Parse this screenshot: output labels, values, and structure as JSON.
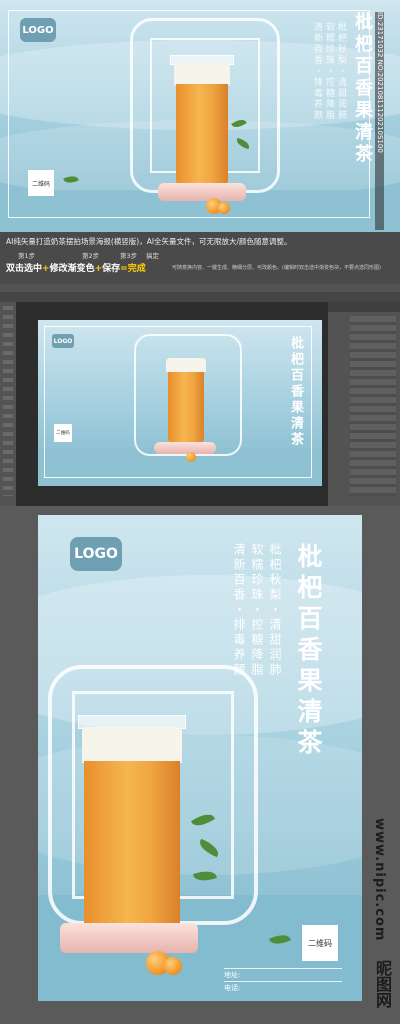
{
  "top_preview": {
    "logo": "LOGO",
    "title_vertical": "枇杷百香果清茶",
    "slogan_col1": "枇杷秋梨・清甜润肺",
    "slogan_col2": "软糯珍珠・控糖降脂",
    "slogan_col3": "清新百香・排毒养颜",
    "qr_label": "二维码",
    "id_text": "ID:23171032 NO:20210811120210S100"
  },
  "info": {
    "description": "AI纯矢量打造奶茶摆拍场景海报(横竖版)，AI全矢量文件，可无限放大/颜色随意调整。",
    "steps": [
      "第1步",
      "第2步",
      "第3步",
      "搞定"
    ],
    "action_line": {
      "part1": "双击选中",
      "plus1": "+",
      "part2": "修改渐变色",
      "plus2": "+",
      "part3": "保存",
      "eq": "=",
      "part4": "完成"
    },
    "notes": "可随意换内容、一键生成、精细分层、可改颜色。(编辑时双击选中渐变色块，不要点选同形图)"
  },
  "editor": {
    "logo": "LOGO",
    "title_vertical": "枇杷百香果清茶",
    "qr_label": "二维码"
  },
  "poster": {
    "logo": "LOGO",
    "title_vertical": "枇杷百香果清茶",
    "slogan_col1": "枇杷秋梨・清甜润肺",
    "slogan_col2": "软糯珍珠・控糖降脂",
    "slogan_col3": "清新百香・排毒养颜",
    "qr_label": "二维码",
    "address_label": "地址:",
    "phone_label": "电话:"
  },
  "watermark": {
    "site": "www.nipic.com",
    "brand": "昵图网"
  },
  "colors": {
    "accent_orange": "#f6a83a",
    "bg_blue": "#a9d2e1",
    "logo_blue": "#6f9fb2",
    "plus_yellow": "#ffd200"
  }
}
